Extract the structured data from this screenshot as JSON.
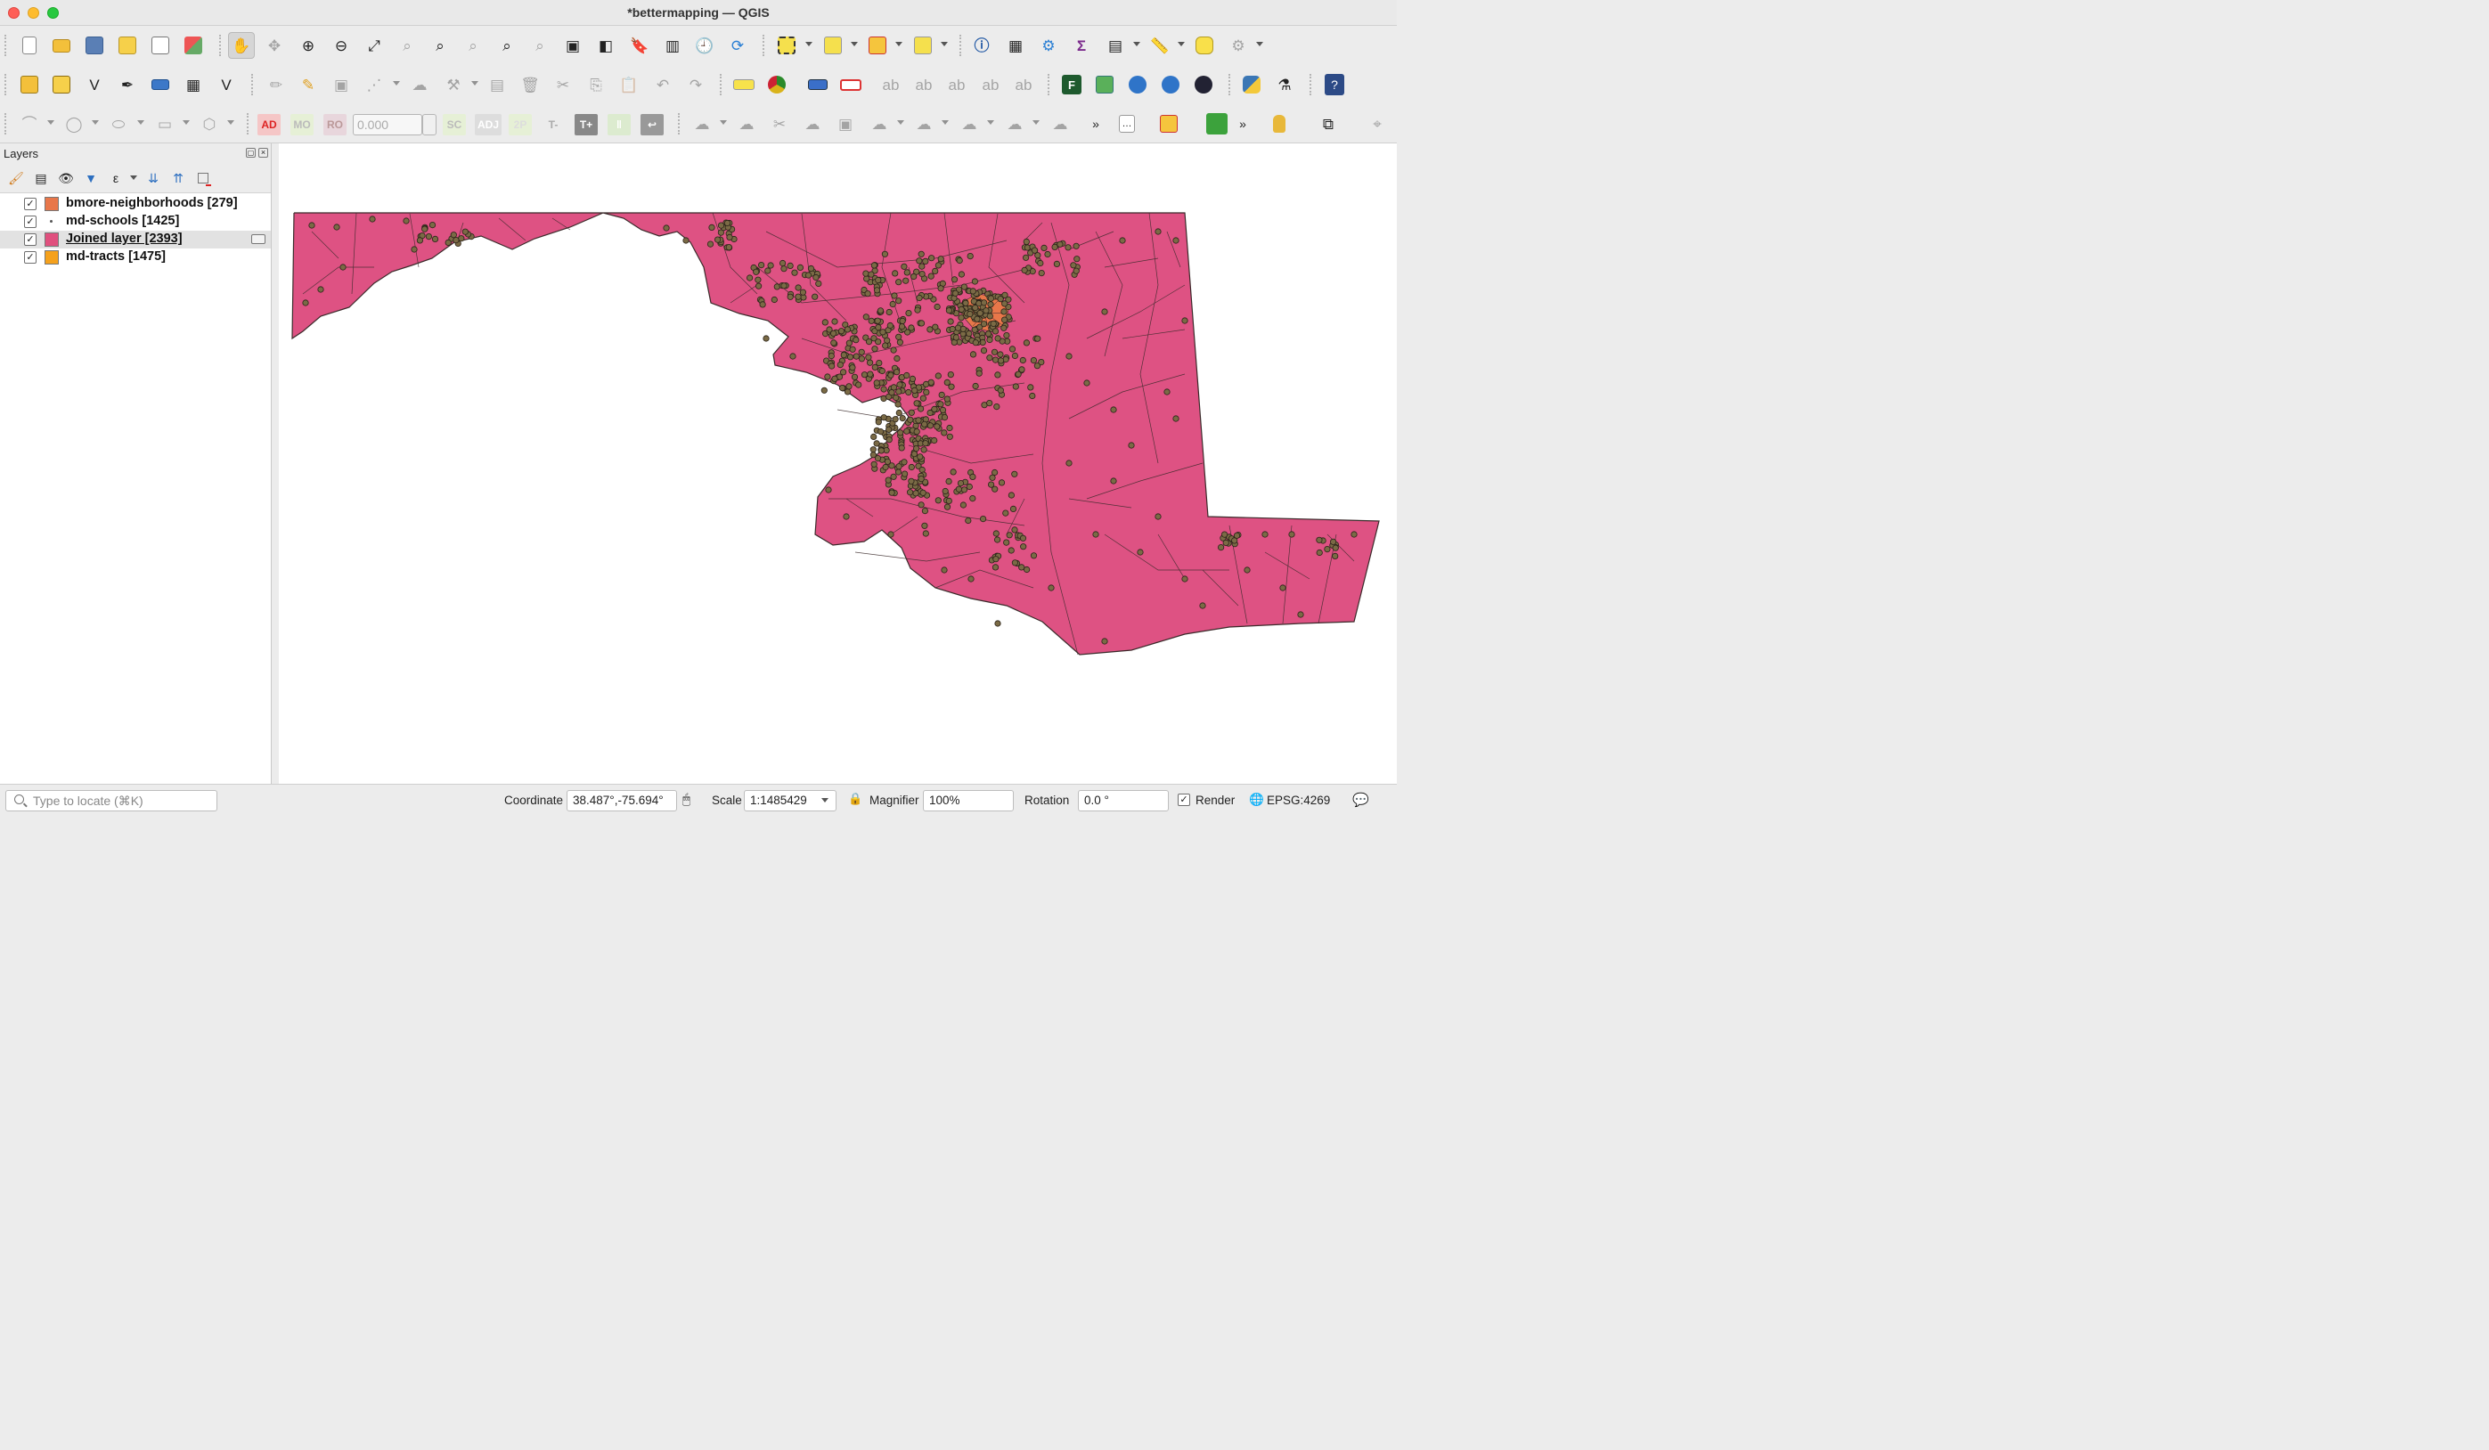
{
  "window": {
    "title": "*bettermapping — QGIS"
  },
  "toolbar3": {
    "width_value": "0.000"
  },
  "layers_panel": {
    "title": "Layers",
    "layers": [
      {
        "name": "bmore-neighborhoods [279]",
        "checked": "✓",
        "swatch": "#e8774a"
      },
      {
        "name": "md-schools [1425]",
        "checked": "✓",
        "swatch": "point"
      },
      {
        "name": "Joined layer [2393]",
        "checked": "✓",
        "swatch": "#e0507e"
      },
      {
        "name": "md-tracts [1475]",
        "checked": "✓",
        "swatch": "#f5a11c"
      }
    ]
  },
  "map": {
    "fill_color": "#de5283",
    "stroke_color": "#3a2a2a",
    "point_color": "#7a6a45",
    "baltimore_color": "#e8774a"
  },
  "statusbar": {
    "locate_placeholder": "Type to locate (⌘K)",
    "coordinate_label": "Coordinate",
    "coordinate_value": "38.487°,-75.694°",
    "scale_label": "Scale",
    "scale_value": "1:1485429",
    "magnifier_label": "Magnifier",
    "magnifier_value": "100%",
    "rotation_label": "Rotation",
    "rotation_value": "0.0 °",
    "render_label": "Render",
    "render_checked": "✓",
    "crs_label": "EPSG:4269"
  }
}
